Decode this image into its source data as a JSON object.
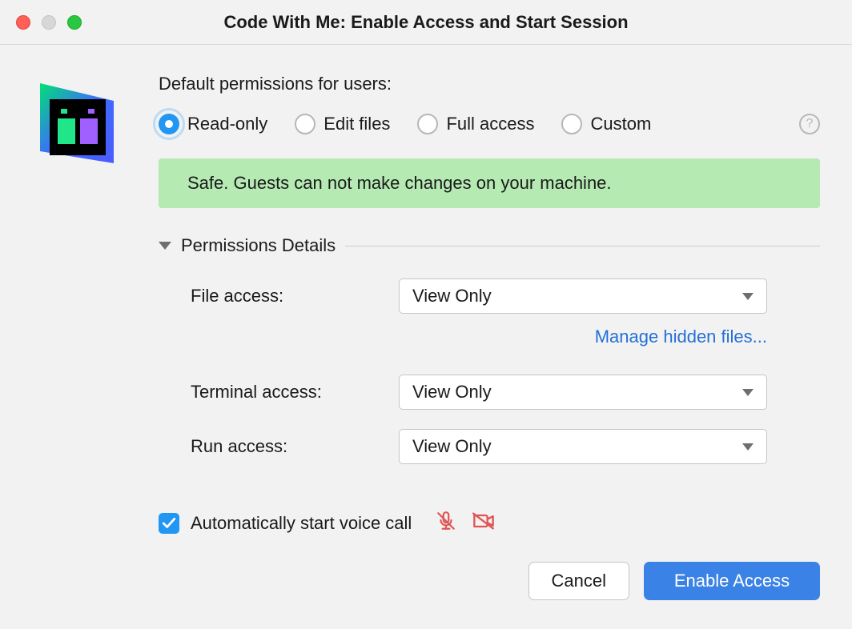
{
  "window": {
    "title": "Code With Me: Enable Access and Start Session"
  },
  "heading": "Default permissions for users:",
  "radios": {
    "read_only": "Read-only",
    "edit_files": "Edit files",
    "full_access": "Full access",
    "custom": "Custom",
    "selected": "read_only"
  },
  "banner": "Safe. Guests can not make changes on your machine.",
  "details": {
    "title": "Permissions Details",
    "file_access": {
      "label": "File access:",
      "value": "View Only"
    },
    "terminal_access": {
      "label": "Terminal access:",
      "value": "View Only"
    },
    "run_access": {
      "label": "Run access:",
      "value": "View Only"
    },
    "manage_link": "Manage hidden files..."
  },
  "voice_call": {
    "label": "Automatically start voice call",
    "checked": true
  },
  "buttons": {
    "cancel": "Cancel",
    "enable": "Enable Access"
  }
}
